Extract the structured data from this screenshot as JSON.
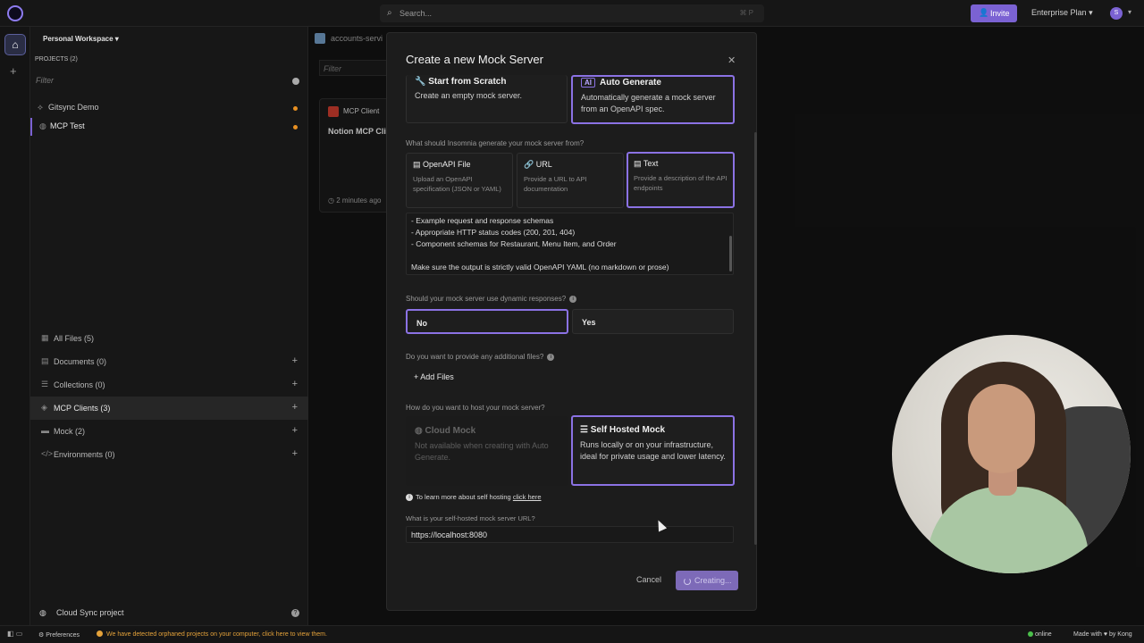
{
  "topbar": {
    "search_placeholder": "Search...",
    "search_shortcut": "⌘ P",
    "invite_label": "Invite",
    "plan_label": "Enterprise Plan",
    "user_initial": "S"
  },
  "sidebar": {
    "workspace": "Personal Workspace",
    "projects_heading": "PROJECTS (2)",
    "filter_placeholder": "Filter",
    "projects": [
      "Gitsync Demo",
      "MCP Test"
    ],
    "nav": {
      "all_files": "All Files (5)",
      "documents": "Documents (0)",
      "collections": "Collections (0)",
      "mcp_clients": "MCP Clients (3)",
      "mock": "Mock (2)",
      "environments": "Environments (0)"
    },
    "cloud_sync": "Cloud Sync project"
  },
  "content": {
    "tab": "accounts-servi",
    "filter_placeholder": "Filter",
    "card": {
      "type": "MCP Client",
      "title": "Notion MCP Cli",
      "time": "2 minutes ago"
    }
  },
  "modal": {
    "title": "Create a new Mock Server",
    "start_title": "Start from Scratch",
    "start_desc": "Create an empty mock server.",
    "ai_badge": "AI",
    "auto_title": "Auto Generate",
    "auto_desc": "Automatically generate a mock server from an OpenAPI spec.",
    "source_question": "What should Insomnia generate your mock server from?",
    "sources": [
      {
        "title": "OpenAPI File",
        "desc": "Upload an OpenAPI specification (JSON or YAML)"
      },
      {
        "title": "URL",
        "desc": "Provide a URL to API documentation"
      },
      {
        "title": "Text",
        "desc": "Provide a description of the API endpoints"
      }
    ],
    "prompt_text": "- Example request and response schemas\n- Appropriate HTTP status codes (200, 201, 404)\n- Component schemas for Restaurant, Menu Item, and Order\n\nMake sure the output is strictly valid OpenAPI YAML (no markdown or prose)",
    "dynamic_question": "Should your mock server use dynamic responses?",
    "dynamic_no": "No",
    "dynamic_yes": "Yes",
    "files_question": "Do you want to provide any additional files?",
    "add_files": "Add Files",
    "host_question": "How do you want to host your mock server?",
    "cloud_title": "Cloud Mock",
    "cloud_desc": "Not available when creating with Auto Generate.",
    "self_title": "Self Hosted Mock",
    "self_desc": "Runs locally or on your infrastructure, ideal for private usage and lower latency.",
    "hosting_note": "To learn more about self hosting",
    "hosting_link": "click here",
    "url_question": "What is your self-hosted mock server URL?",
    "url_value": "https://localhost:8080",
    "cancel": "Cancel",
    "creating": "Creating..."
  },
  "statusbar": {
    "preferences": "Preferences",
    "orphan_notice": "We have detected orphaned projects on your computer, click here to view them.",
    "online": "online",
    "made_with": "Made with ♥ by Kong"
  },
  "colors": {
    "accent": "#7b62d3",
    "warning": "#e89022",
    "online": "#4bbf4b"
  }
}
